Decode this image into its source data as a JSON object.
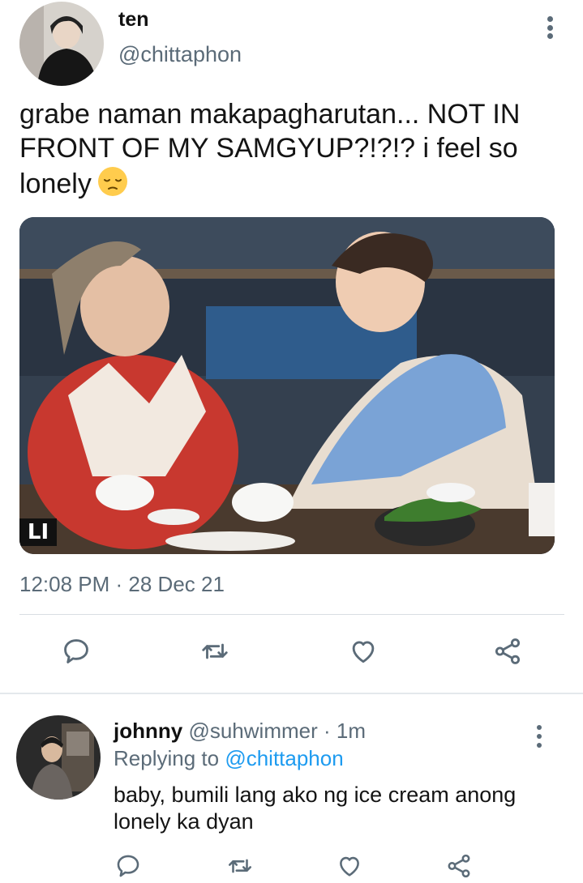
{
  "tweet": {
    "display_name": "ten",
    "handle": "@chittaphon",
    "text": "grabe naman makapagharutan... NOT IN FRONT OF MY SAMGYUP?!?!? i feel so lonely",
    "emoji": "pensive-face",
    "media_watermark": "LI",
    "timestamp": "12:08 PM · 28 Dec 21",
    "actions": [
      "reply-icon",
      "retweet-icon",
      "like-icon",
      "share-icon"
    ]
  },
  "reply": {
    "display_name": "johnny",
    "handle": "@suhwimmer",
    "separator": " · ",
    "time": "1m",
    "replying_prefix": "Replying to ",
    "replying_to": "@chittaphon",
    "text": "baby, bumili lang ako ng ice cream anong lonely ka dyan",
    "actions": [
      "reply-icon",
      "retweet-icon",
      "like-icon",
      "share-icon"
    ]
  },
  "colors": {
    "secondary_text": "#5b6b78",
    "link": "#1d9bf0",
    "divider": "#d9dee3"
  }
}
